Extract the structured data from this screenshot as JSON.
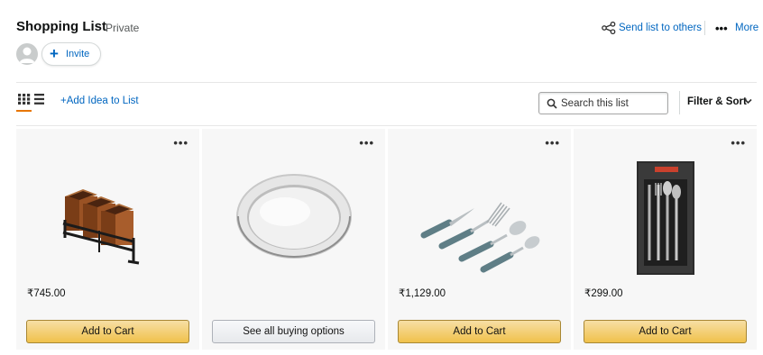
{
  "header": {
    "title": "Shopping List",
    "privacy": "Private",
    "invite_label": "Invite",
    "invite_plus": "+",
    "send_list_label": "Send list to others",
    "more_dots": "•••",
    "more_label": "More"
  },
  "toolbar": {
    "add_idea_label": "+Add Idea to List",
    "search_placeholder": "Search this list",
    "filter_sort_label": "Filter & Sort"
  },
  "items": [
    {
      "name": "Utensil holder",
      "price": "₹745.00",
      "button_label": "Add to Cart",
      "button_type": "add-to-cart",
      "menu": "•••"
    },
    {
      "name": "Steel plate",
      "price": "",
      "button_label": "See all buying options",
      "button_type": "see-options",
      "menu": "•••"
    },
    {
      "name": "Cutlery set",
      "price": "₹1,129.00",
      "button_label": "Add to Cart",
      "button_type": "add-to-cart",
      "menu": "•••"
    },
    {
      "name": "Boxed cutlery set",
      "price": "₹299.00",
      "button_label": "Add to Cart",
      "button_type": "add-to-cart",
      "menu": "•••"
    }
  ],
  "colors": {
    "link": "#0066c0",
    "accent": "#e77600",
    "card_bg": "#f7f7f7",
    "cart_button": "#f0c14b"
  },
  "icons": {
    "send": "share-nodes-icon",
    "search": "magnifier-icon",
    "grid_view": "grid-icon",
    "list_view": "list-icon",
    "chevron": "chevron-down-icon"
  }
}
